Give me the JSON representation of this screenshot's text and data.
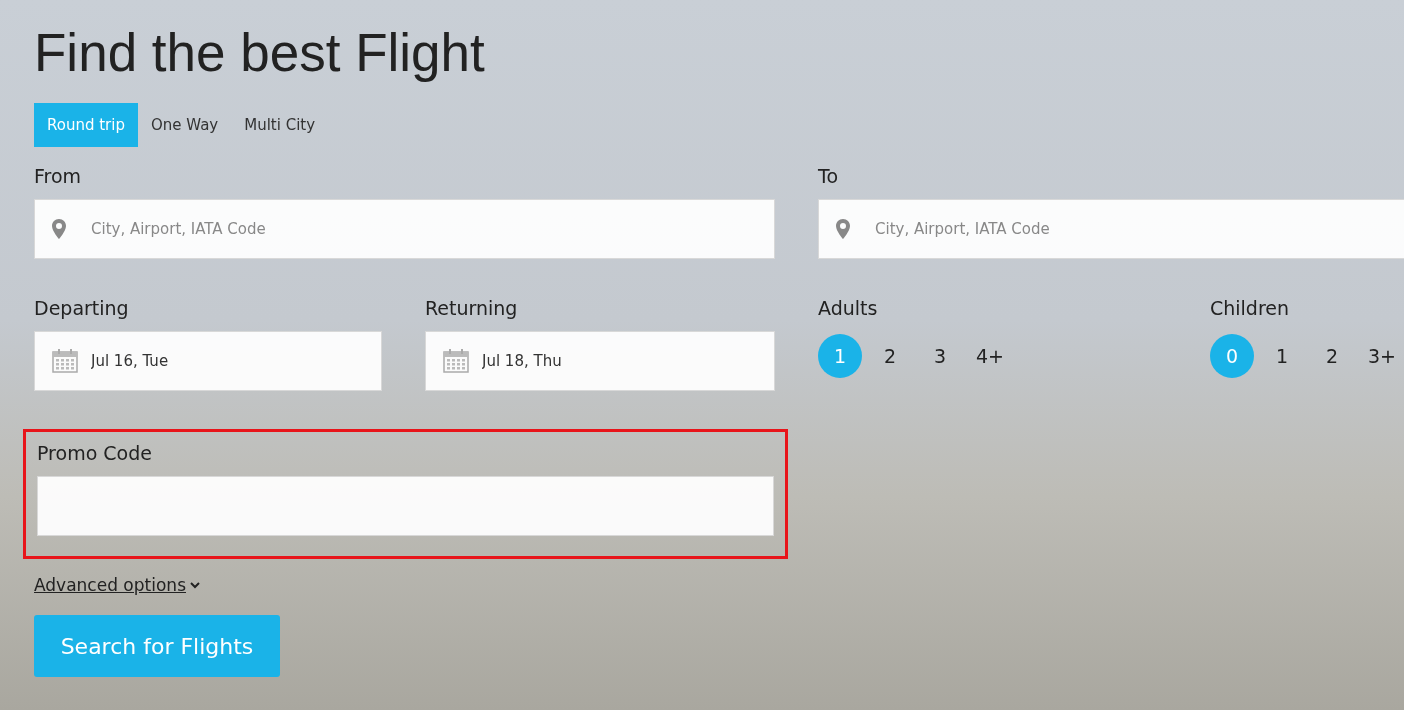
{
  "title": "Find the best Flight",
  "trip_types": [
    {
      "label": "Round trip",
      "selected": true
    },
    {
      "label": "One Way",
      "selected": false
    },
    {
      "label": "Multi City",
      "selected": false
    }
  ],
  "from": {
    "label": "From",
    "placeholder": "City, Airport, IATA Code"
  },
  "to": {
    "label": "To",
    "placeholder": "City, Airport, IATA Code"
  },
  "departing": {
    "label": "Departing",
    "value": "Jul 16, Tue"
  },
  "returning": {
    "label": "Returning",
    "value": "Jul 18, Thu"
  },
  "adults": {
    "label": "Adults",
    "options": [
      {
        "label": "1",
        "selected": true
      },
      {
        "label": "2",
        "selected": false
      },
      {
        "label": "3",
        "selected": false
      },
      {
        "label": "4+",
        "selected": false
      }
    ]
  },
  "children": {
    "label": "Children",
    "options": [
      {
        "label": "0",
        "selected": true
      },
      {
        "label": "1",
        "selected": false
      },
      {
        "label": "2",
        "selected": false
      },
      {
        "label": "3+",
        "selected": false
      }
    ]
  },
  "promo": {
    "label": "Promo Code",
    "highlighted": true
  },
  "advanced_options": "Advanced options",
  "search_button": "Search for Flights"
}
